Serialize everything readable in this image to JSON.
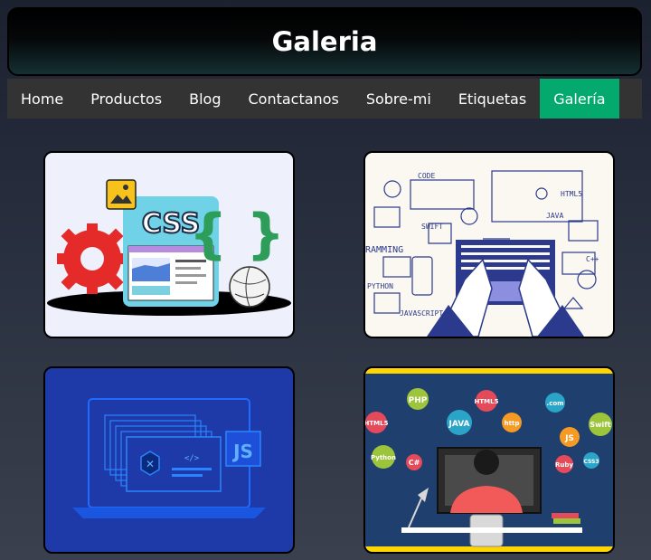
{
  "header": {
    "title": "Galeria"
  },
  "nav": {
    "items": [
      {
        "label": "Home"
      },
      {
        "label": "Productos"
      },
      {
        "label": "Blog"
      },
      {
        "label": "Contactanos"
      },
      {
        "label": "Sobre-mi"
      },
      {
        "label": "Etiquetas"
      },
      {
        "label": "Galería"
      }
    ],
    "active_index": 6,
    "active_color": "#04aa6d"
  },
  "gallery": {
    "images": [
      {
        "name": "css-illustration",
        "badge": "CSS"
      },
      {
        "name": "programming-keyboard-illustration",
        "labels": [
          "CODE",
          "HTML5",
          "SWIFT",
          "JAVA",
          "RAMMING",
          "PYTHON",
          "JAVASCRIPT",
          "C++"
        ]
      },
      {
        "name": "laptop-javascript-illustration",
        "badge": "JS"
      },
      {
        "name": "developer-languages-illustration",
        "labels": [
          "PHP",
          "HTML5",
          "JAVA",
          ".com",
          "HTML5",
          "http",
          "Swift",
          "JS",
          "Python",
          "C#",
          "Ruby",
          "CSS3"
        ]
      }
    ]
  }
}
